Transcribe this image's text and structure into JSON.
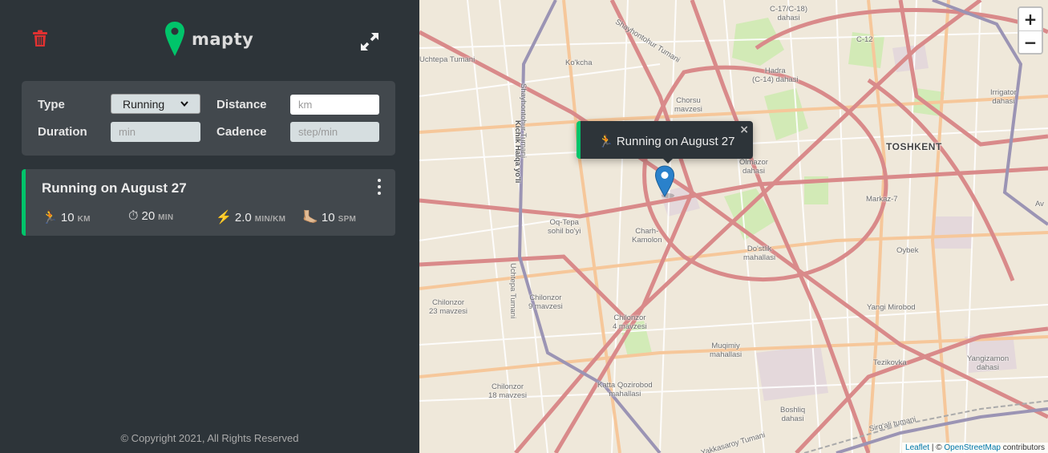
{
  "app": {
    "name": "mapty"
  },
  "form": {
    "type_label": "Type",
    "type_value": "Running",
    "distance_label": "Distance",
    "distance_placeholder": "km",
    "duration_label": "Duration",
    "duration_placeholder": "min",
    "cadence_label": "Cadence",
    "cadence_placeholder": "step/min"
  },
  "workouts": [
    {
      "title": "Running on August 27",
      "accent": "#00c46a",
      "details": [
        {
          "icon": "🏃",
          "value": "10",
          "unit": "km"
        },
        {
          "icon": "⏱",
          "value": "20",
          "unit": "min"
        },
        {
          "icon": "⚡",
          "value": "2.0",
          "unit": "min/km"
        },
        {
          "icon": "🦶🏼",
          "value": "10",
          "unit": "spm"
        }
      ]
    }
  ],
  "footer": {
    "copyright": "© Copyright 2021, All Rights Reserved"
  },
  "map": {
    "popup_text": "🏃 Running on August 27",
    "popup_close": "×",
    "zoom_in": "+",
    "zoom_out": "−",
    "attribution_leaflet": "Leaflet",
    "attribution_sep": " | © ",
    "attribution_osm": "OpenStreetMap",
    "attribution_rest": " contributors",
    "labels": {
      "toshkent": "TOSHKENT",
      "shayhontohur": "Shayhontohur Tumani",
      "shayhontohur_v": "Shayhontohur Tumani",
      "uchtepa_top": "Uchtepa Tumani",
      "uchtepa_v": "Uchtepa Tumani",
      "kichik_halqa": "Kichik Halqa yo'li",
      "kokcha": "Ko'kcha",
      "chorsu": "Chorsu\nmavzesi",
      "hadra": "Hadra\n(C-14) dahasi",
      "dahasi_top": "C-17/C-18)\ndahasi",
      "c12": "C-12",
      "irrigator": "Irrigator\ndahasi",
      "olmazor": "Olmazor\ndahasi",
      "markaz7": "Markaz-7",
      "oqtepa": "Oq-Tepa\nsohil bo'yi",
      "charh": "Charh-\nKamolon",
      "dostlik": "Do'stlik\nmahallasi",
      "oybek": "Oybek",
      "chilonzor9": "Chilonzor\n9 mavzesi",
      "chilonzor23": "Chilonzor\n23 mavzesi",
      "chilonzor4": "Chilonzor\n4 mavzesi",
      "yangi_mirobod": "Yangi Mirobod",
      "muqimiy": "Muqimiy\nmahallasi",
      "tezikovka": "Tezikovka",
      "yangizamon": "Yangizamon\ndahasi",
      "chilonzor18": "Chilonzor\n18 mavzesi",
      "katta_qozirobod": "Katta Qozirobod\nmahallasi",
      "boshliq": "Boshliq\ndahasi",
      "sirgali": "Sirg'ali tumani",
      "yakkasaroy": "Yakkasaroy Tumani",
      "ay": "Av"
    }
  }
}
